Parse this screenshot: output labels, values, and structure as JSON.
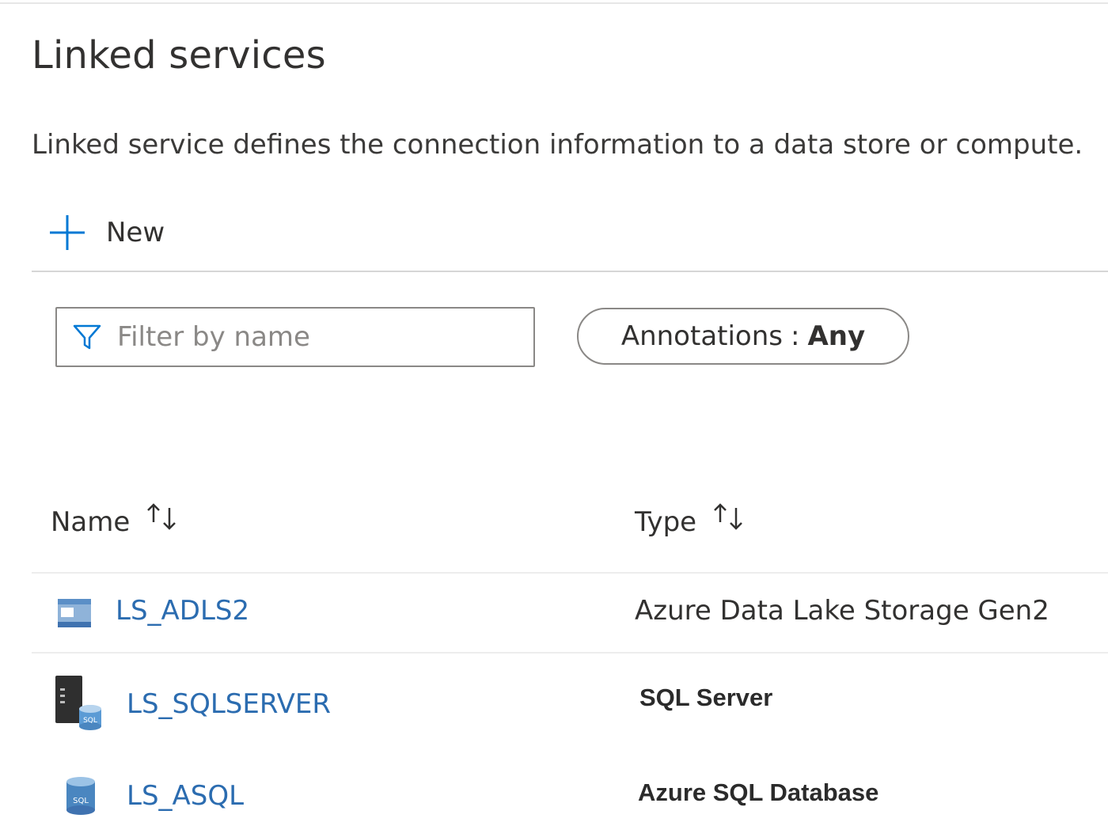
{
  "page": {
    "title": "Linked services",
    "description": "Linked service defines the connection information to a data store or compute."
  },
  "toolbar": {
    "new_label": "New"
  },
  "filter": {
    "placeholder": "Filter by name",
    "annotations_label": "Annotations",
    "annotations_separator": ":",
    "annotations_value": "Any"
  },
  "table": {
    "columns": [
      {
        "label": "Name",
        "sortable": true
      },
      {
        "label": "Type",
        "sortable": true
      }
    ],
    "rows": [
      {
        "name": "LS_ADLS2",
        "type": "Azure Data Lake Storage Gen2",
        "icon": "storage-account-icon"
      },
      {
        "name": "LS_SQLSERVER",
        "type": "SQL Server",
        "icon": "sql-server-icon"
      },
      {
        "name": "LS_ASQL",
        "type": "Azure SQL Database",
        "icon": "azure-sql-database-icon"
      }
    ]
  },
  "colors": {
    "link": "#2b6cb0",
    "accent": "#0078d4",
    "text": "#323130",
    "border": "#8a8886"
  }
}
